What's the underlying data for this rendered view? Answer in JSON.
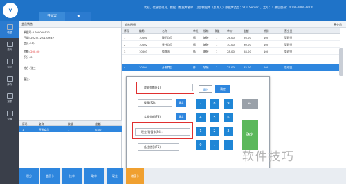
{
  "app": {
    "logo_text": "V",
    "tabs": [
      "开文案",
      "◀"
    ],
    "top_info": "欢迎，信息管理员，数据（数据库名称：总部数据库（负责人）数据库类型：SQL Server），工号：1 最后登录：0000-0000-0000"
  },
  "sidenav": [
    {
      "label": "收银",
      "icon": "cashier-icon"
    },
    {
      "label": "查询",
      "icon": "search-icon"
    },
    {
      "label": "会员",
      "icon": "member-icon"
    },
    {
      "label": "库存",
      "icon": "inventory-icon"
    },
    {
      "label": "报表",
      "icon": "report-icon"
    },
    {
      "label": "设置",
      "icon": "settings-icon"
    }
  ],
  "left": {
    "title": "会员销售",
    "fields": [
      {
        "label": "单据号:",
        "value": "LS00000112"
      },
      {
        "label": "日期:",
        "value": "2025/12/01 09:47"
      },
      {
        "label": "会员卡号:",
        "value": ""
      },
      {
        "label": "余额:",
        "value": "200.00"
      },
      {
        "label": "积分:",
        "value": "0"
      },
      {
        "label": "姓名:",
        "value": "张三"
      },
      {
        "label": "备注:",
        "value": ""
      }
    ],
    "grid_headers": [
      "序号",
      "名称",
      "数量",
      "金额"
    ],
    "grid_row": [
      "1",
      "开发商品",
      "1",
      "0.00"
    ],
    "footer": [
      "合计:",
      "0.00"
    ]
  },
  "main": {
    "title": "销售明细",
    "right_label": "营业员",
    "headers": [
      "序号",
      "编码",
      "名称",
      "单位",
      "规格",
      "数量",
      "单价",
      "金额",
      "折扣",
      "营业员"
    ],
    "rows": [
      [
        "1",
        "10001",
        "酸奶饮品",
        "瓶",
        "箱装",
        "1",
        "26.00",
        "26.00",
        "100",
        "管理员"
      ],
      [
        "2",
        "10002",
        "果汁饮品",
        "瓶",
        "箱装",
        "1",
        "30.00",
        "30.00",
        "100",
        "管理员"
      ],
      [
        "3",
        "10003",
        "纯净水",
        "瓶",
        "箱装",
        "1",
        "28.00",
        "28.00",
        "100",
        "管理员"
      ],
      [
        "4",
        "10004",
        "开发商品",
        "件",
        "袋装",
        "1",
        "25.00",
        "25.00",
        "100",
        "管理员"
      ]
    ]
  },
  "dialog": {
    "fields": [
      "收款金额(F1):",
      "找零(F2):",
      "实收金额(F3):",
      "现金/储值卡(F4):",
      "备注信息(F5):"
    ],
    "small_buttons": [
      "确定",
      "清空"
    ],
    "keys": [
      "7",
      "8",
      "9",
      "←",
      "4",
      "5",
      "6",
      "",
      "1",
      "2",
      "3",
      "",
      "0",
      ".",
      "",
      "确定"
    ]
  },
  "buttons": [
    "积分",
    "会员卡",
    "挂单",
    "取单",
    "现金",
    "储值卡",
    "微信",
    "结账"
  ],
  "watermark": "软件技巧"
}
